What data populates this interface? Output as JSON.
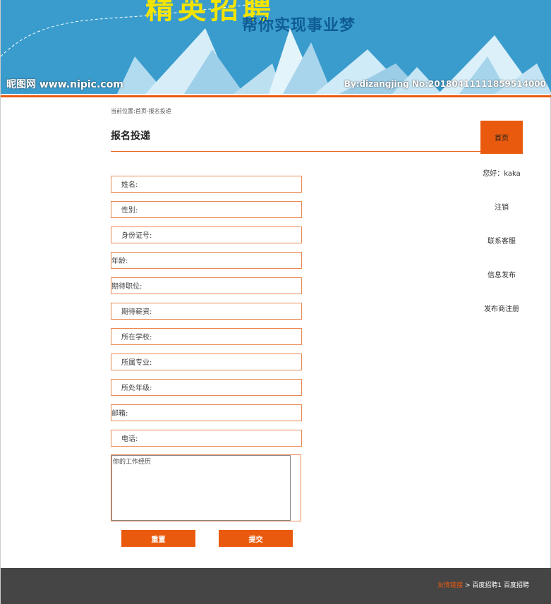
{
  "banner": {
    "title": "精英招聘",
    "slogan": "帮你实现事业梦",
    "watermark_left": "昵图网 www.nipic.com",
    "watermark_right": "By:dizangjing No:20180411111859514000"
  },
  "breadcrumb": "当前位置:首页-报名投递",
  "page_title": "报名投递",
  "nav": {
    "home": "首页",
    "greeting": "您好：kaka",
    "logout": "注销",
    "contact": "联系客服",
    "publish": "信息发布",
    "publisher_register": "发布商注册"
  },
  "form": {
    "name": "姓名:",
    "gender": "性别:",
    "id_number": "身份证号:",
    "age": "年龄:",
    "expected_position": "期待职位:",
    "expected_salary": "期待薪资:",
    "school": "所在学校:",
    "major": "所属专业:",
    "grade": "所处年级:",
    "email": "邮箱:",
    "phone": "电话:",
    "experience": "你的工作经历",
    "reset": "重置",
    "submit": "提交"
  },
  "footer": {
    "links_label": "友情链接",
    "separator": ">",
    "links": "百度招聘1 百度招聘"
  },
  "colors": {
    "accent": "#ea5a0e",
    "banner_bg": "#3a9ccd",
    "footer_bg": "#454545"
  }
}
